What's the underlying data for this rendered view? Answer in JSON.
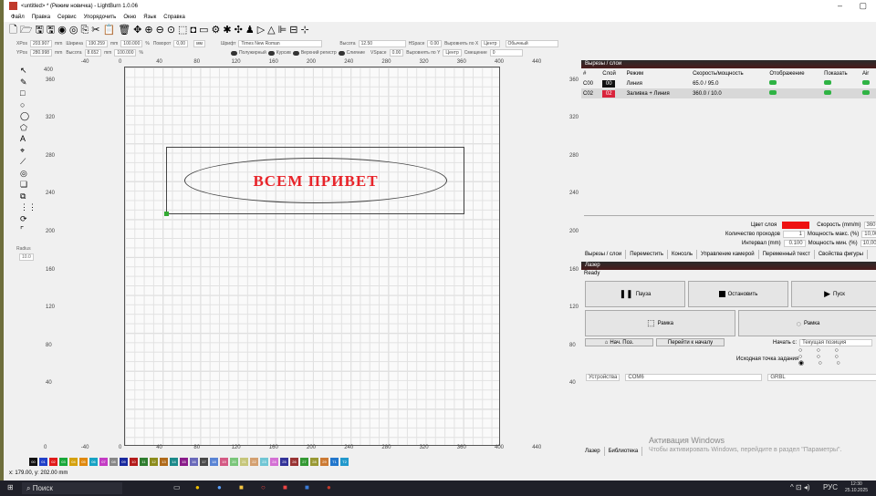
{
  "window": {
    "title": "<untitled> * (Режим новичка) - LightBurn 1.0.06",
    "min": "–",
    "max": "▢"
  },
  "menu": [
    "Файл",
    "Правка",
    "Сервис",
    "Упорядочить",
    "Окно",
    "Язык",
    "Справка"
  ],
  "toolbar_icons": [
    "new-file-icon",
    "open-icon",
    "save-icon",
    "save-as-icon",
    "import-icon",
    "export-icon",
    "copy-icon",
    "cut-icon",
    "paste-icon",
    "delete-icon",
    "move-icon",
    "zoom-in-icon",
    "zoom-out-icon",
    "zoom-fit-icon",
    "select-frame-icon",
    "camera-icon",
    "monitor-icon",
    "settings-icon",
    "tools-icon",
    "align-icon",
    "user-icon",
    "run-icon",
    "triangle-icon",
    "align-left-icon",
    "text-icon",
    "center-icon"
  ],
  "props": {
    "xpos_label": "XPos",
    "xpos": "203.907",
    "ypos_label": "YPos",
    "ypos": "280.998",
    "mm": "mm",
    "width_label": "Ширина",
    "width": "190.259",
    "height_label": "Высота",
    "height": "8.652",
    "scale_w": "100.000",
    "scale_h": "100.000",
    "pct": "%",
    "rotate_label": "Поворот",
    "rotate": "0,00",
    "mm_btn": "мм",
    "font_label": "Шрифт",
    "font": "Times New Roman",
    "fheight_label": "Высота",
    "fheight": "12.50",
    "hspace_label": "HSpace",
    "hspace": "0.00",
    "vspace_label": "VSpace",
    "vspace": "0.00",
    "alignx_label": "Выровнять по X",
    "alignx": "Центр",
    "aligny_label": "Выровнять по Y",
    "aligny": "Центр",
    "style": "Обычный",
    "offset_label": "Смещение",
    "offset": "0",
    "bold": "Полужирный",
    "italic": "Курсив",
    "upper": "Верхний регистр",
    "merge": "Слияние"
  },
  "left_tools": [
    "cursor-icon",
    "pen-icon",
    "rectangle-icon",
    "circle-icon",
    "ellipse-icon",
    "polygon-icon",
    "text-tool-icon",
    "position-icon",
    "measure-icon",
    "offset-icon",
    "weld-icon",
    "boolean-icon",
    "grid-array-icon",
    "circle-array-icon",
    "corner-icon"
  ],
  "radius": {
    "label": "Radius",
    "value": "10.0"
  },
  "canvas": {
    "xticks": [
      "-40",
      "0",
      "40",
      "80",
      "120",
      "160",
      "200",
      "240",
      "280",
      "320",
      "360",
      "400",
      "440"
    ],
    "yticks": [
      "360",
      "320",
      "280",
      "240",
      "200",
      "160",
      "120",
      "80",
      "40"
    ],
    "corner_top": "400",
    "corner_bottom": "0",
    "text": "ВСЕМ ПРИВЕТ",
    "text_color": "#e8242a"
  },
  "layers_panel": {
    "title": "Вырезы / слои",
    "headers": [
      "#",
      "Слой",
      "Режим",
      "Скорость/мощность",
      "Отображение",
      "Показать",
      "Air"
    ],
    "rows": [
      {
        "num": "C00",
        "layer": "00",
        "mode": "Линия",
        "speed": "65.0 / 95.0",
        "color": "#111111"
      },
      {
        "num": "C02",
        "layer": "02",
        "mode": "Заливка + Линия",
        "speed": "360.0 / 10.0",
        "color": "#d9233b"
      }
    ],
    "layer_color_label": "Цвет слоя",
    "layer_color": "#ee1111",
    "passes_label": "Количество проходов",
    "passes": "1",
    "interval_label": "Интервал (mm)",
    "interval": "0.100",
    "speed_label": "Скорость (mm/m)",
    "speed": "360",
    "maxp_label": "Мощность макс. (%)",
    "maxp": "10,00",
    "minp_label": "Мощность мин. (%)",
    "minp": "10,00"
  },
  "tabs": [
    "Вырезы / слои",
    "Переместить",
    "Консоль",
    "Управление камерой",
    "Переменный текст",
    "Свойства фигуры"
  ],
  "laser_panel": {
    "title": "Лазер",
    "status": "Ready",
    "pause": "Пауза",
    "stop": "Остановить",
    "start": "Пуск",
    "frame1": "Рамка",
    "frame2": "Рамка",
    "home": "Нач. Поз.",
    "goto": "Перейти к началу",
    "start_from_label": "Начать с:",
    "start_from": "Текущая позиция",
    "origin_label": "Исходная точка задания",
    "devices": "Устройства",
    "port": "COM6",
    "controller": "GRBL"
  },
  "bottom_tabs": [
    "Лазер",
    "Библиотека"
  ],
  "palette": [
    {
      "n": "00",
      "c": "#111111"
    },
    {
      "n": "01",
      "c": "#2140c8"
    },
    {
      "n": "02",
      "c": "#e01b1b"
    },
    {
      "n": "03",
      "c": "#19a83a"
    },
    {
      "n": "04",
      "c": "#d4a10d"
    },
    {
      "n": "05",
      "c": "#e0890f"
    },
    {
      "n": "06",
      "c": "#18a3c4"
    },
    {
      "n": "07",
      "c": "#c43cc4"
    },
    {
      "n": "08",
      "c": "#888888"
    },
    {
      "n": "09",
      "c": "#1a2a9e"
    },
    {
      "n": "10",
      "c": "#b41c1c"
    },
    {
      "n": "11",
      "c": "#2f7d2f"
    },
    {
      "n": "12",
      "c": "#8c8c1c"
    },
    {
      "n": "13",
      "c": "#b06a1a"
    },
    {
      "n": "14",
      "c": "#1c8a8a"
    },
    {
      "n": "15",
      "c": "#8a1c8a"
    },
    {
      "n": "16",
      "c": "#6a6aba"
    },
    {
      "n": "17",
      "c": "#4a4a4a"
    },
    {
      "n": "18",
      "c": "#5a84d4"
    },
    {
      "n": "19",
      "c": "#d45a84"
    },
    {
      "n": "20",
      "c": "#7ac67a"
    },
    {
      "n": "21",
      "c": "#c6c67a"
    },
    {
      "n": "22",
      "c": "#d4a070"
    },
    {
      "n": "23",
      "c": "#70c6d4"
    },
    {
      "n": "24",
      "c": "#d470d4"
    },
    {
      "n": "25",
      "c": "#333399"
    },
    {
      "n": "26",
      "c": "#993333"
    },
    {
      "n": "27",
      "c": "#339933"
    },
    {
      "n": "28",
      "c": "#999933"
    },
    {
      "n": "29",
      "c": "#cc7a33"
    },
    {
      "n": "T1",
      "c": "#2277cc"
    },
    {
      "n": "T2",
      "c": "#2299cc"
    }
  ],
  "status_bar": "x: 179.00, y: 202.00 mm",
  "watermark": {
    "line1": "Активация Windows",
    "line2": "Чтобы активировать Windows, перейдите в раздел \"Параметры\"."
  },
  "taskbar": {
    "search": "Поиск",
    "lang": "РУС",
    "time": "12:30",
    "date": "25.10.2025"
  }
}
